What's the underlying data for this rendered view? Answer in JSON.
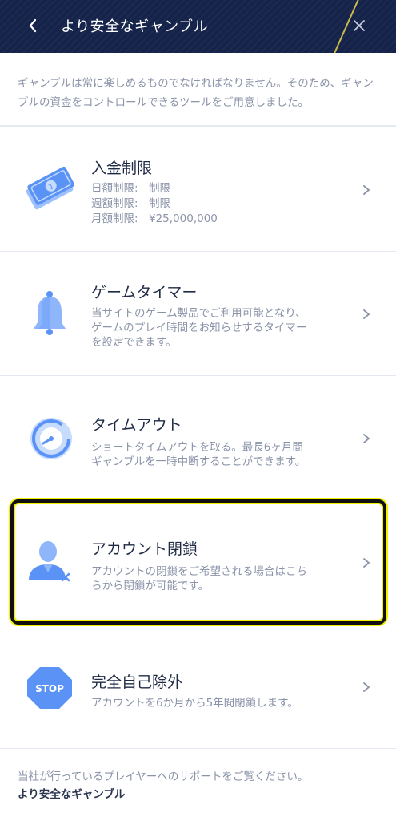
{
  "header": {
    "title": "より安全なギャンブル"
  },
  "intro": {
    "text": "ギャンブルは常に楽しめるものでなければなりません。そのため、ギャンブルの資金をコントロールできるツールをご用意しました。"
  },
  "items": [
    {
      "title": "入金制限",
      "limits": [
        {
          "label": "日額制限:",
          "value": "制限"
        },
        {
          "label": "週額制限:",
          "value": "制限"
        },
        {
          "label": "月額制限:",
          "value": "¥25,000,000"
        }
      ],
      "icon": "money-icon"
    },
    {
      "title": "ゲームタイマー",
      "desc": [
        "当サイトのゲーム製品でご利用可能となり、",
        "ゲームのプレイ時間をお知らせするタイマー",
        "を設定できます。"
      ],
      "icon": "bell-icon"
    },
    {
      "title": "タイムアウト",
      "desc": [
        "ショートタイムアウトを取る。最長6ヶ月間",
        "ギャンブルを一時中断することができます。"
      ],
      "icon": "timer-icon"
    },
    {
      "title": "アカウント閉鎖",
      "desc": [
        "アカウントの閉鎖をご希望される場合はこち",
        "らから閉鎖が可能です。"
      ],
      "icon": "user-close-icon"
    },
    {
      "title": "完全自己除外",
      "desc": [
        "アカウントを6か月から5年間閉鎖します。"
      ],
      "icon": "stop-sign-icon",
      "stop_text": "STOP"
    }
  ],
  "footer": {
    "text": "当社が行っているプレイヤーへのサポートをご覧ください。",
    "link": "より安全なギャンブル"
  },
  "colors": {
    "header_bg": "#15224a",
    "icon_blue": "#5a93f5",
    "highlight": "#f2f200"
  }
}
